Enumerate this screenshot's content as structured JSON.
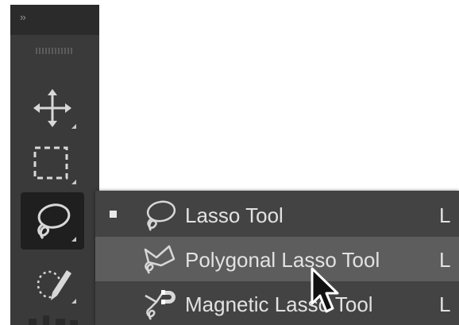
{
  "toolbar": {
    "collapse_glyph": "››",
    "tools": [
      {
        "icon": "move-icon",
        "name": "Move Tool"
      },
      {
        "icon": "rectangular-marquee-icon",
        "name": "Rectangular Marquee Tool"
      },
      {
        "icon": "lasso-icon",
        "name": "Lasso Tool",
        "active": true
      },
      {
        "icon": "quick-selection-icon",
        "name": "Quick Selection Tool"
      }
    ]
  },
  "flyout": {
    "items": [
      {
        "label": "Lasso Tool",
        "shortcut": "L",
        "icon": "lasso-icon",
        "checked": true
      },
      {
        "label": "Polygonal Lasso Tool",
        "shortcut": "L",
        "icon": "polygonal-lasso-icon",
        "hover": true
      },
      {
        "label": "Magnetic Lasso Tool",
        "shortcut": "L",
        "icon": "magnetic-lasso-icon"
      }
    ]
  },
  "colors": {
    "toolbar_bg": "#3a3a3a",
    "menu_bg": "#434343",
    "menu_hover": "#5d5d5d",
    "text": "#e2e2e2"
  }
}
